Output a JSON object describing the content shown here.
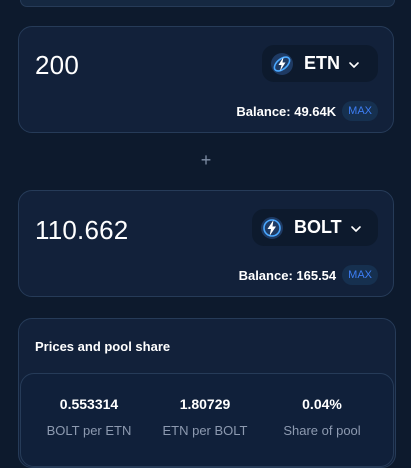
{
  "etn_input": {
    "amount": "200",
    "token": "ETN",
    "balance": "Balance: 49.64K",
    "max_label": "MAX"
  },
  "plus_symbol": "+",
  "bolt_input": {
    "amount": "110.662",
    "token": "BOLT",
    "balance": "Balance: 165.54",
    "max_label": "MAX"
  },
  "prices": {
    "title": "Prices and pool share",
    "items": [
      {
        "value": "0.553314",
        "label": "BOLT per ETN"
      },
      {
        "value": "1.80729",
        "label": "ETN per BOLT"
      },
      {
        "value": "0.04%",
        "label": "Share of pool"
      }
    ]
  },
  "colors": {
    "background": "#0d1a2d",
    "card": "#12213a",
    "border": "#263b58",
    "accent": "#3d7ef5",
    "muted_text": "#8d9ab0"
  },
  "icons": {
    "etn": "electroneum-logo-icon",
    "bolt": "bolt-token-logo-icon",
    "chevron": "chevron-down-icon"
  }
}
